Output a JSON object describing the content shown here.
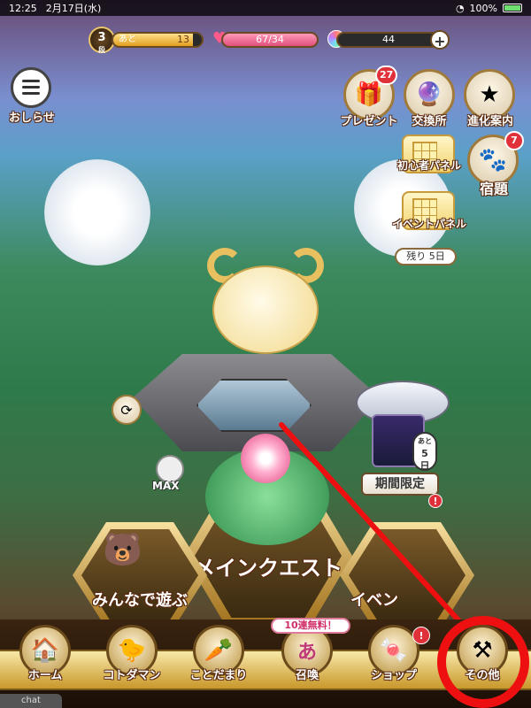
{
  "status_bar": {
    "time": "12:25",
    "date": "2月17日(水)",
    "battery": "100%"
  },
  "player": {
    "rank_number": "3",
    "rank_suffix": "段",
    "exp_prefix": "あと",
    "exp_value": "13",
    "exp_progress": 0.9,
    "hearts": "67/34",
    "gems": "44"
  },
  "buttons": {
    "notice": "おしらせ",
    "present": "プレゼント",
    "present_count": "27",
    "exchange": "交換所",
    "evolution": "進化案内",
    "beginner_panel": "初心者パネル",
    "homework": "宿題",
    "homework_count": "7",
    "event_panel": "イベントパネル",
    "event_panel_days": "残り 5日"
  },
  "main_area": {
    "max_label": "MAX",
    "main_quest": "メインクエスト",
    "play_together": "みんなで遊ぶ",
    "event": "イベン",
    "limited": "期間限定",
    "limited_days_top": "あと",
    "limited_days_num": "5",
    "limited_days_unit": "日",
    "alert_mark": "!"
  },
  "nav": {
    "items": [
      {
        "label": "ホーム",
        "icon": "home-icon"
      },
      {
        "label": "コトダマン",
        "icon": "kotodaman-icon"
      },
      {
        "label": "ことだまり",
        "icon": "kotodamari-icon"
      },
      {
        "label": "召喚",
        "icon": "summon-icon"
      },
      {
        "label": "ショップ",
        "icon": "shop-icon"
      },
      {
        "label": "その他",
        "icon": "tools-icon"
      }
    ],
    "summon_banner": "10連無料！",
    "summon_char": "あ",
    "shop_alert": "!",
    "chat": "chat"
  },
  "colors": {
    "highlight": "#ee1010",
    "arrow": "#ee1010",
    "gold": "#c8982a"
  }
}
